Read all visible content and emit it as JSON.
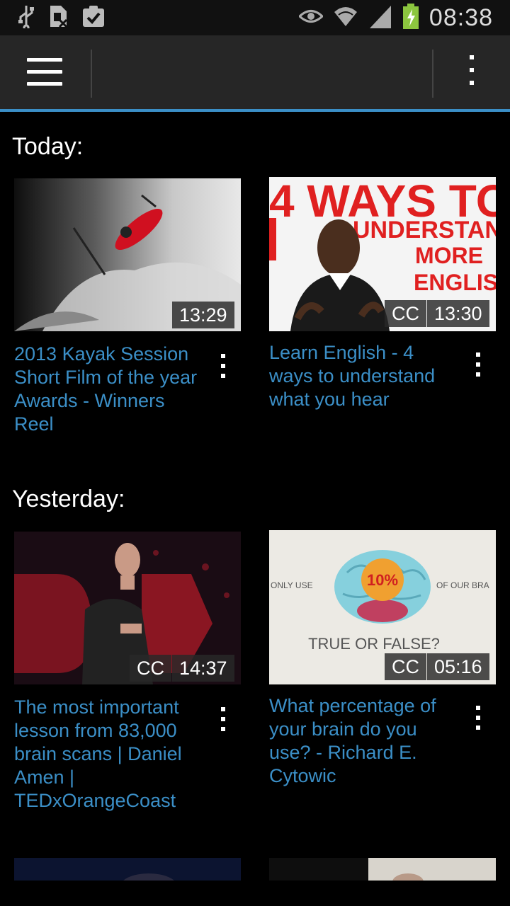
{
  "status_bar": {
    "time": "08:38",
    "icons": [
      "usb-icon",
      "no-sim-icon",
      "clipboard-check-icon",
      "eye-icon",
      "wifi-icon",
      "signal-icon",
      "battery-charging-icon"
    ]
  },
  "app_bar": {
    "icons": [
      "hamburger-menu-icon",
      "overflow-menu-icon"
    ]
  },
  "sections": [
    {
      "label": "Today:",
      "videos": [
        {
          "title": "2013 Kayak Session Short Film of the year Awards - Winners Reel",
          "duration": "13:29",
          "cc": ""
        },
        {
          "title": "Learn English - 4 ways to understand what you hear",
          "duration": "13:30",
          "cc": "CC",
          "thumb_text": {
            "line1": "4 WAYS TO",
            "line2": "UNDERSTAN",
            "line3": "MORE",
            "line4": "ENGLIS"
          }
        }
      ]
    },
    {
      "label": "Yesterday:",
      "videos": [
        {
          "title": "The most important lesson from 83,000 brain scans | Daniel Amen | TEDxOrangeCoast",
          "duration": "14:37",
          "cc": "CC"
        },
        {
          "title": "What percentage of your brain do you use? - Richard E. Cytowic",
          "duration": "05:16",
          "cc": "CC",
          "thumb_text": {
            "left": "ONLY USE",
            "right": "OF OUR BRA",
            "pct": "10%",
            "bottom": "TRUE OR FALSE?"
          }
        }
      ]
    }
  ],
  "colors": {
    "accent": "#3b8fc7",
    "background": "#000000",
    "app_bar": "#262626"
  }
}
